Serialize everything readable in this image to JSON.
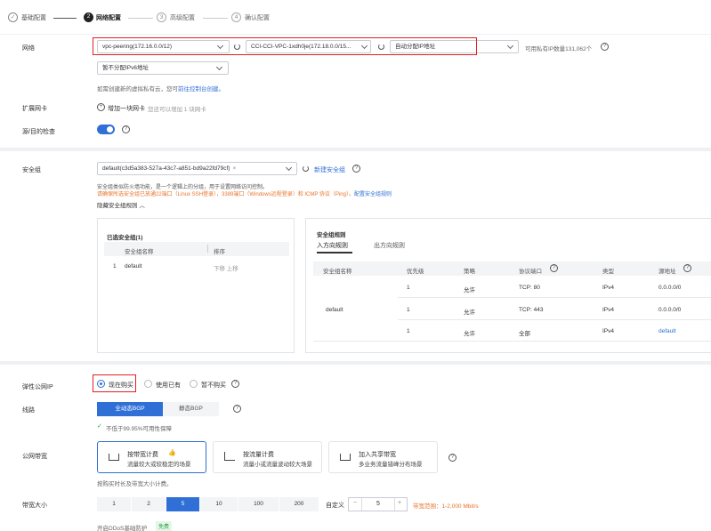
{
  "steps": [
    {
      "num": "",
      "label": "基础配置",
      "state": "done"
    },
    {
      "num": "2",
      "label": "网络配置",
      "state": "active"
    },
    {
      "num": "3",
      "label": "高级配置",
      "state": "todo"
    },
    {
      "num": "4",
      "label": "确认配置",
      "state": "todo"
    }
  ],
  "network": {
    "label": "网络",
    "vpc": "vpc-peering(172.16.0.0/12)",
    "subnet": "CCI-CCI-VPC-1xdh0je(172.18.0.0/15...",
    "ip_mode": "自动分配IP地址",
    "avail_ips": "可用私有IP数量131,062个",
    "ipv6": "暂不分配IPv6地址",
    "hint_prefix": "如需创建新的虚拟私有云，您可",
    "hint_link": "前往控制台创建。"
  },
  "nic": {
    "label": "扩展网卡",
    "add": "增加一块网卡",
    "hint": "您还可以增加 1 块网卡"
  },
  "srcdst": {
    "label": "源/目的检查"
  },
  "secgroup": {
    "label": "安全组",
    "value": "default(c3d5a383-527a-43c7-a851-bd9a22fd79cf)",
    "new_link": "新建安全组",
    "desc": "安全组类似防火墙功能，是一个逻辑上的分组，用于设置网络访问控制。",
    "warn": "请确保所选安全组已放通22端口（Linux SSH登录），3389端口（Windows远程登录）和 ICMP 协议（Ping）。",
    "warn_link": "配置安全组规则",
    "hide_rules": "隐藏安全组规则",
    "selected_title": "已选安全组(1)",
    "sel_headers": [
      "安全组名称",
      "排序"
    ],
    "sel_rows": [
      {
        "idx": "1",
        "name": "default",
        "actions": "下移 上移"
      }
    ],
    "rules_title": "安全组规则",
    "tab_in": "入方向规则",
    "tab_out": "出方向规则",
    "rule_headers": [
      "安全组名称",
      "优先级",
      "策略",
      "协议端口",
      "类型",
      "源地址"
    ],
    "rule_group": "default",
    "rules": [
      {
        "prio": "1",
        "policy": "允许",
        "port": "TCP: 80",
        "type": "IPv4",
        "src": "0.0.0.0/0"
      },
      {
        "prio": "1",
        "policy": "允许",
        "port": "TCP: 443",
        "type": "IPv4",
        "src": "0.0.0.0/0"
      },
      {
        "prio": "1",
        "policy": "允许",
        "port": "全部",
        "type": "IPv4",
        "src": "default"
      }
    ]
  },
  "eip": {
    "label": "弹性公网IP",
    "opt_buy": "现在购买",
    "opt_use": "使用已有",
    "opt_none": "暂不购买",
    "line_label": "线路",
    "line_full": "全动态BGP",
    "line_static": "静态BGP",
    "sla": "不低于99.95%可用性保障",
    "bw_label": "公网带宽",
    "bw_cards": [
      {
        "title": "按带宽计费",
        "sub": "流量较大或较稳定的场景"
      },
      {
        "title": "按流量计费",
        "sub": "流量小或流量波动较大场景"
      },
      {
        "title": "加入共享带宽",
        "sub": "多业务流量错峰分布场景"
      }
    ],
    "bw_hint": "按购买时长及带宽大小计费。",
    "size_label": "带宽大小",
    "sizes": [
      "1",
      "2",
      "5",
      "10",
      "100",
      "200"
    ],
    "custom": "自定义",
    "value": "5",
    "range": "带宽范围：1-2,000 Mbit/s",
    "ddos": "开启DDoS基础防护",
    "free": "免费"
  },
  "colors": {
    "accent": "#2f6fd6",
    "warn": "#e8722a",
    "highlight": "#e02020"
  }
}
